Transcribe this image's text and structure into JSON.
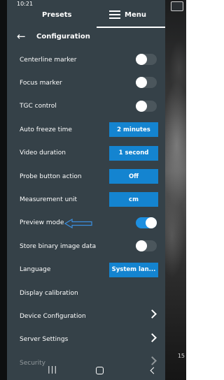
{
  "status_bar": {
    "time": "10:21"
  },
  "tabs": {
    "presets_label": "Presets",
    "menu_label": "Menu"
  },
  "header": {
    "title": "Configuration"
  },
  "rows": [
    {
      "label": "Centerline marker",
      "control": "toggle",
      "on": false
    },
    {
      "label": "Focus marker",
      "control": "toggle",
      "on": false
    },
    {
      "label": "TGC control",
      "control": "toggle",
      "on": false
    },
    {
      "label": "Auto freeze time",
      "control": "button",
      "value": "2 minutes"
    },
    {
      "label": "Video duration",
      "control": "button",
      "value": "1 second"
    },
    {
      "label": "Probe button action",
      "control": "button",
      "value": "Off"
    },
    {
      "label": "Measurement unit",
      "control": "button",
      "value": "cm"
    },
    {
      "label": "Preview mode",
      "control": "toggle",
      "on": true
    },
    {
      "label": "Store binary image data",
      "control": "toggle",
      "on": false
    },
    {
      "label": "Language",
      "control": "button",
      "value": "System lan..."
    },
    {
      "label": "Display calibration",
      "control": "none"
    },
    {
      "label": "Device Configuration",
      "control": "chevron"
    },
    {
      "label": "Server Settings",
      "control": "chevron"
    },
    {
      "label": "Security",
      "control": "chevron"
    }
  ],
  "ultrasound": {
    "scale_label": "15"
  },
  "nav_bar": {
    "recent_icon": "recent-apps-icon",
    "home_icon": "home-icon",
    "back_icon": "back-icon"
  },
  "colors": {
    "panel": "#354148",
    "accent": "#1484d0",
    "toggle_on": "#1d8fe0"
  }
}
